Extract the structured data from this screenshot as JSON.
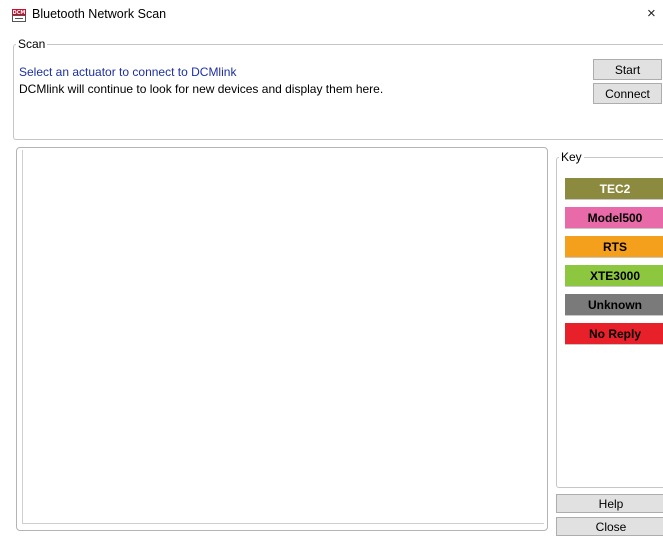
{
  "window": {
    "title": "Bluetooth Network Scan",
    "close_glyph": "×",
    "app_icon": "dcm-app-icon"
  },
  "scan": {
    "legend": "Scan",
    "instruction": "Select an actuator to connect to DCMlink",
    "description": "DCMlink will continue to look for new devices and display them here.",
    "start_label": "Start",
    "connect_label": "Connect"
  },
  "key": {
    "legend": "Key",
    "items": [
      {
        "label": "TEC2",
        "bg": "#8c8a3f",
        "color": "#ffffff"
      },
      {
        "label": "Model500",
        "bg": "#e86aa8",
        "color": "#000000"
      },
      {
        "label": "RTS",
        "bg": "#f5a01c",
        "color": "#000000"
      },
      {
        "label": "XTE3000",
        "bg": "#8dc63f",
        "color": "#000000"
      },
      {
        "label": "Unknown",
        "bg": "#7a7a7a",
        "color": "#000000"
      },
      {
        "label": "No Reply",
        "bg": "#e8202a",
        "color": "#000000"
      }
    ]
  },
  "footer": {
    "help_label": "Help",
    "close_label": "Close"
  }
}
